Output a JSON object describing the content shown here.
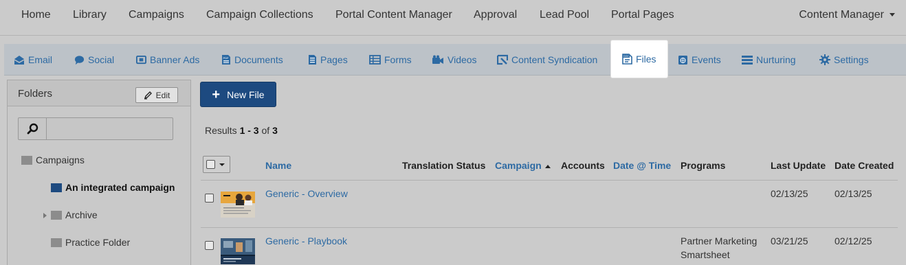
{
  "topnav": {
    "items": [
      "Home",
      "Library",
      "Campaigns",
      "Campaign Collections",
      "Portal Content Manager",
      "Approval",
      "Lead Pool",
      "Portal Pages"
    ],
    "user_menu": "Content Manager"
  },
  "subnav": {
    "tabs": [
      {
        "label": "Email",
        "icon": "email-icon"
      },
      {
        "label": "Social",
        "icon": "speech-bubble-icon"
      },
      {
        "label": "Banner Ads",
        "icon": "banner-icon"
      },
      {
        "label": "Documents",
        "icon": "pdf-document-icon"
      },
      {
        "label": "Pages",
        "icon": "page-icon"
      },
      {
        "label": "Forms",
        "icon": "form-icon"
      },
      {
        "label": "Videos",
        "icon": "video-camera-icon"
      },
      {
        "label": "Content Syndication",
        "icon": "syndication-icon"
      },
      {
        "label": "Files",
        "icon": "doc-file-icon",
        "active": true
      },
      {
        "label": "Events",
        "icon": "calendar-globe-icon"
      },
      {
        "label": "Nurturing",
        "icon": "list-icon"
      },
      {
        "label": "Settings",
        "icon": "gear-icon"
      }
    ],
    "accent_color": "#2d6aa3"
  },
  "folders": {
    "title": "Folders",
    "edit_label": "Edit",
    "search_placeholder": "",
    "tree": [
      {
        "label": "Campaigns",
        "color": "#8c8c8c"
      },
      {
        "label": "An integrated campaign",
        "color": "#1d4a80",
        "selected": true
      },
      {
        "label": "Archive",
        "color": "#8c8c8c",
        "collapsed": true
      },
      {
        "label": "Practice Folder",
        "color": "#8c8c8c"
      }
    ]
  },
  "main": {
    "new_button": "New File",
    "results": {
      "prefix": "Results ",
      "range": "1 - 3",
      "of": " of ",
      "total": "3"
    },
    "columns": [
      "Name",
      "Translation Status",
      "Campaign",
      "Accounts",
      "Date @ Time",
      "Programs",
      "Last Update",
      "Date Created"
    ],
    "rows": [
      {
        "name": "Generic - Overview",
        "programs": [
          "",
          ""
        ],
        "last_update": "02/13/25",
        "date_created": "02/13/25"
      },
      {
        "name": "Generic - Playbook",
        "programs": [
          "Partner Marketing",
          "Smartsheet"
        ],
        "last_update": "03/21/25",
        "date_created": "02/12/25"
      }
    ]
  }
}
